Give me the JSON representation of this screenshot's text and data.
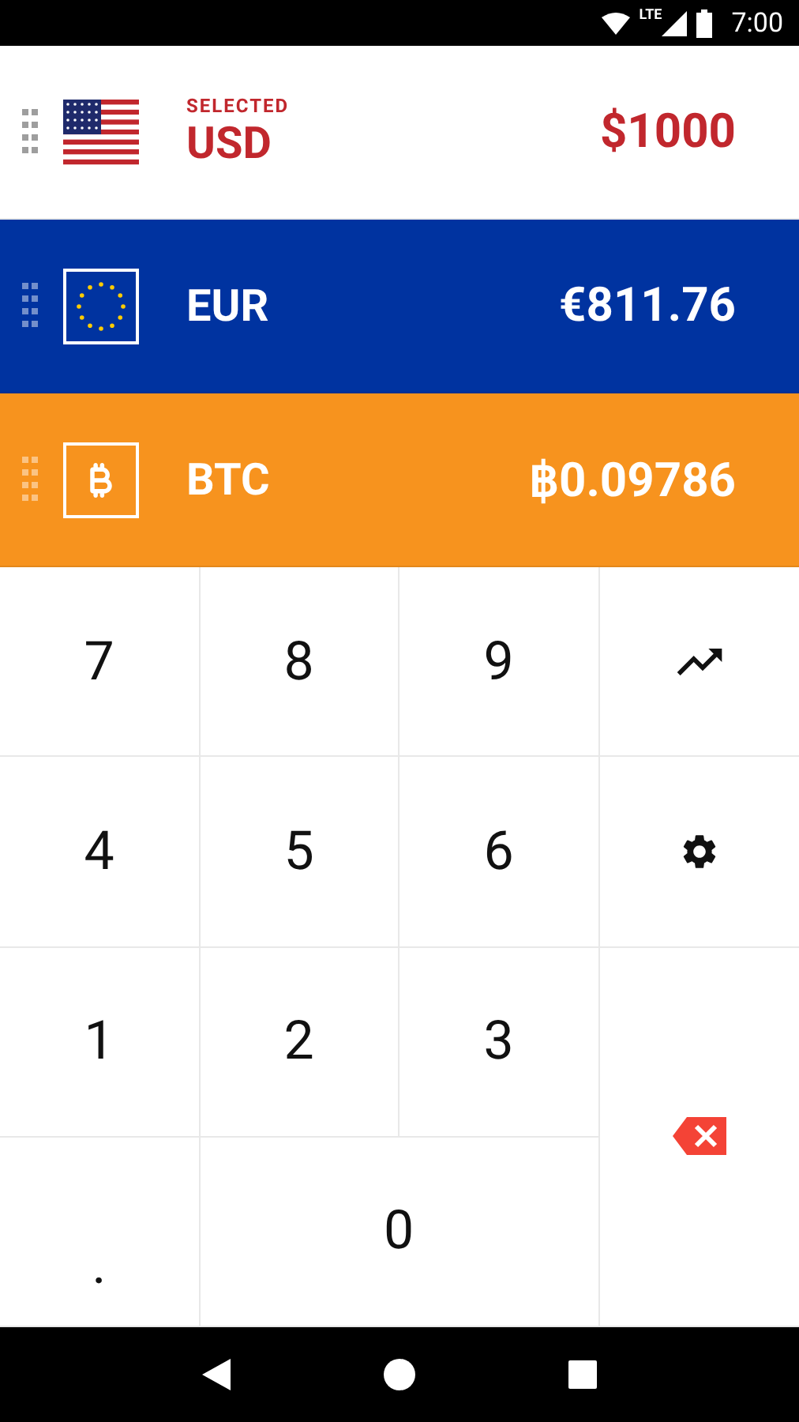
{
  "status_bar": {
    "network": "LTE",
    "time": "7:00"
  },
  "currencies": [
    {
      "kind": "us",
      "label": "SELECTED",
      "code": "USD",
      "amount": "$1000",
      "selected": true,
      "color": "#ffffff"
    },
    {
      "kind": "eu",
      "code": "EUR",
      "amount": "€811.76",
      "selected": false,
      "color": "#0033a0"
    },
    {
      "kind": "btc",
      "code": "BTC",
      "amount": "฿0.09786",
      "selected": false,
      "color": "#f7931e"
    }
  ],
  "keypad": [
    {
      "kind": "digit",
      "text": "7"
    },
    {
      "kind": "digit",
      "text": "8"
    },
    {
      "kind": "digit",
      "text": "9"
    },
    {
      "kind": "trend"
    },
    {
      "kind": "digit",
      "text": "4"
    },
    {
      "kind": "digit",
      "text": "5"
    },
    {
      "kind": "digit",
      "text": "6"
    },
    {
      "kind": "settings"
    },
    {
      "kind": "digit",
      "text": "1"
    },
    {
      "kind": "digit",
      "text": "2"
    },
    {
      "kind": "digit",
      "text": "3"
    },
    {
      "kind": "backspace"
    },
    {
      "kind": "dot",
      "text": "."
    },
    {
      "kind": "wide_digit",
      "text": "0"
    }
  ]
}
